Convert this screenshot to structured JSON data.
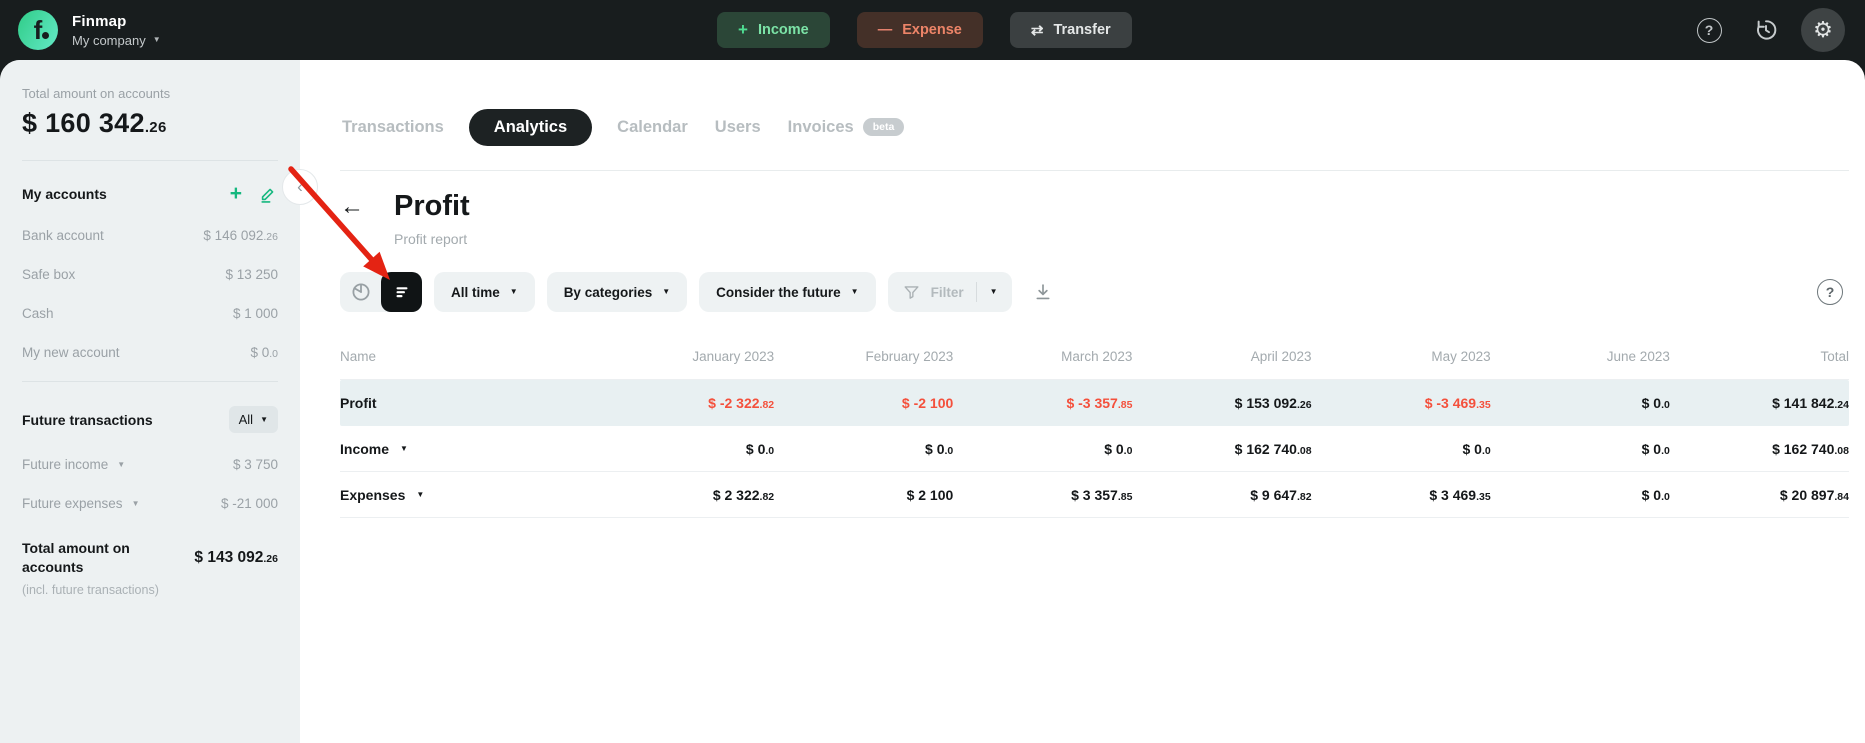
{
  "topbar": {
    "brand": "Finmap",
    "company": "My company",
    "income": "Income",
    "expense": "Expense",
    "transfer": "Transfer"
  },
  "sidebar": {
    "total_label": "Total amount on accounts",
    "total": {
      "m": "$ 160 342",
      "d": ".26"
    },
    "accounts_header": "My accounts",
    "accounts": [
      {
        "name": "Bank account",
        "m": "$ 146 092",
        "d": ".26"
      },
      {
        "name": "Safe box",
        "m": "$ 13 250",
        "d": ""
      },
      {
        "name": "Cash",
        "m": "$ 1 000",
        "d": ""
      },
      {
        "name": "My new account",
        "m": "$ 0",
        "d": ".0"
      }
    ],
    "future_header": "Future transactions",
    "future_filter": "All",
    "future": [
      {
        "name": "Future income",
        "m": "$ 3 750",
        "d": ""
      },
      {
        "name": "Future expenses",
        "m": "$ -21 000",
        "d": ""
      }
    ],
    "bottom_label": "Total amount on accounts",
    "bottom_note": "(incl. future transactions)",
    "bottom_total": {
      "m": "$ 143 092",
      "d": ".26"
    }
  },
  "tabs": [
    {
      "label": "Transactions",
      "active": false
    },
    {
      "label": "Analytics",
      "active": true
    },
    {
      "label": "Calendar",
      "active": false
    },
    {
      "label": "Users",
      "active": false
    },
    {
      "label": "Invoices",
      "active": false,
      "badge": "beta"
    }
  ],
  "page": {
    "title": "Profit",
    "subtitle": "Profit report"
  },
  "toolbar": {
    "all_time": "All time",
    "by_categories": "By categories",
    "consider_future": "Consider the future",
    "filter": "Filter"
  },
  "table": {
    "columns": [
      "Name",
      "January 2023",
      "February 2023",
      "March 2023",
      "April 2023",
      "May 2023",
      "June 2023",
      "Total"
    ],
    "rows": [
      {
        "name": "Profit",
        "caret": false,
        "highlight": true,
        "cells": [
          {
            "m": "$ -2 322",
            "d": ".82",
            "neg": true
          },
          {
            "m": "$ -2 100",
            "d": "",
            "neg": true
          },
          {
            "m": "$ -3 357",
            "d": ".85",
            "neg": true
          },
          {
            "m": "$ 153 092",
            "d": ".26",
            "neg": false
          },
          {
            "m": "$ -3 469",
            "d": ".35",
            "neg": true
          },
          {
            "m": "$ 0",
            "d": ".0",
            "neg": false
          },
          {
            "m": "$ 141 842",
            "d": ".24",
            "neg": false
          }
        ]
      },
      {
        "name": "Income",
        "caret": true,
        "highlight": false,
        "cells": [
          {
            "m": "$ 0",
            "d": ".0",
            "neg": false
          },
          {
            "m": "$ 0",
            "d": ".0",
            "neg": false
          },
          {
            "m": "$ 0",
            "d": ".0",
            "neg": false
          },
          {
            "m": "$ 162 740",
            "d": ".08",
            "neg": false
          },
          {
            "m": "$ 0",
            "d": ".0",
            "neg": false
          },
          {
            "m": "$ 0",
            "d": ".0",
            "neg": false
          },
          {
            "m": "$ 162 740",
            "d": ".08",
            "neg": false
          }
        ]
      },
      {
        "name": "Expenses",
        "caret": true,
        "highlight": false,
        "cells": [
          {
            "m": "$ 2 322",
            "d": ".82",
            "neg": false
          },
          {
            "m": "$ 2 100",
            "d": "",
            "neg": false
          },
          {
            "m": "$ 3 357",
            "d": ".85",
            "neg": false
          },
          {
            "m": "$ 9 647",
            "d": ".82",
            "neg": false
          },
          {
            "m": "$ 3 469",
            "d": ".35",
            "neg": false
          },
          {
            "m": "$ 0",
            "d": ".0",
            "neg": false
          },
          {
            "m": "$ 20 897",
            "d": ".84",
            "neg": false
          }
        ]
      }
    ]
  },
  "colors": {
    "accent_green": "#16b87f",
    "negative_red": "#f4503c",
    "active_dark": "#1d2223"
  }
}
